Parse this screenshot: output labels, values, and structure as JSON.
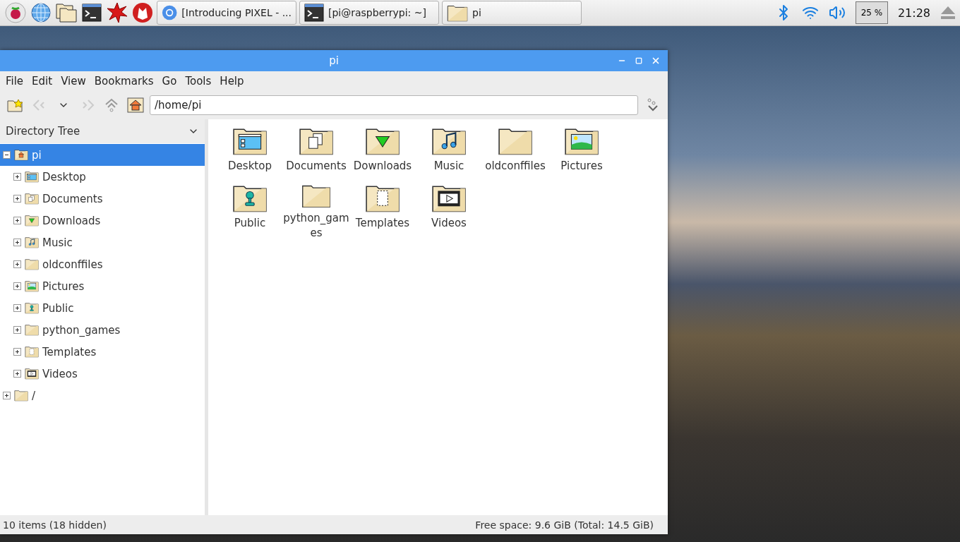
{
  "taskbar": {
    "tasks": [
      {
        "label": "[Introducing PIXEL - ...",
        "kind": "browser"
      },
      {
        "label": "[pi@raspberrypi: ~]",
        "kind": "terminal"
      },
      {
        "label": "pi",
        "kind": "folder"
      }
    ],
    "cpu": "25 %",
    "clock": "21:28"
  },
  "window": {
    "title": "pi",
    "menu": [
      "File",
      "Edit",
      "View",
      "Bookmarks",
      "Go",
      "Tools",
      "Help"
    ],
    "path": "/home/pi"
  },
  "sidebar": {
    "title": "Directory Tree",
    "tree": [
      {
        "label": "pi",
        "kind": "home",
        "expanded": true,
        "selected": true,
        "children": [
          {
            "label": "Desktop",
            "kind": "desktop",
            "expanded": false,
            "selected": false
          },
          {
            "label": "Documents",
            "kind": "documents",
            "expanded": false,
            "selected": false
          },
          {
            "label": "Downloads",
            "kind": "downloads",
            "expanded": false,
            "selected": false
          },
          {
            "label": "Music",
            "kind": "music",
            "expanded": false,
            "selected": false
          },
          {
            "label": "oldconffiles",
            "kind": "plain",
            "expanded": false,
            "selected": false
          },
          {
            "label": "Pictures",
            "kind": "pictures",
            "expanded": false,
            "selected": false
          },
          {
            "label": "Public",
            "kind": "public",
            "expanded": false,
            "selected": false
          },
          {
            "label": "python_games",
            "kind": "plain",
            "expanded": false,
            "selected": false
          },
          {
            "label": "Templates",
            "kind": "templates",
            "expanded": false,
            "selected": false
          },
          {
            "label": "Videos",
            "kind": "videos",
            "expanded": false,
            "selected": false
          }
        ]
      },
      {
        "label": "/",
        "kind": "plain",
        "expanded": false,
        "selected": false
      }
    ]
  },
  "files": [
    {
      "label": "Desktop",
      "kind": "desktop"
    },
    {
      "label": "Documents",
      "kind": "documents"
    },
    {
      "label": "Downloads",
      "kind": "downloads"
    },
    {
      "label": "Music",
      "kind": "music"
    },
    {
      "label": "oldconffiles",
      "kind": "plain"
    },
    {
      "label": "Pictures",
      "kind": "pictures"
    },
    {
      "label": "Public",
      "kind": "public"
    },
    {
      "label": "python_games",
      "kind": "plain"
    },
    {
      "label": "Templates",
      "kind": "templates"
    },
    {
      "label": "Videos",
      "kind": "videos"
    }
  ],
  "status_bar": {
    "left": "10 items (18 hidden)",
    "right": "Free space: 9.6 GiB (Total: 14.5 GiB)"
  }
}
